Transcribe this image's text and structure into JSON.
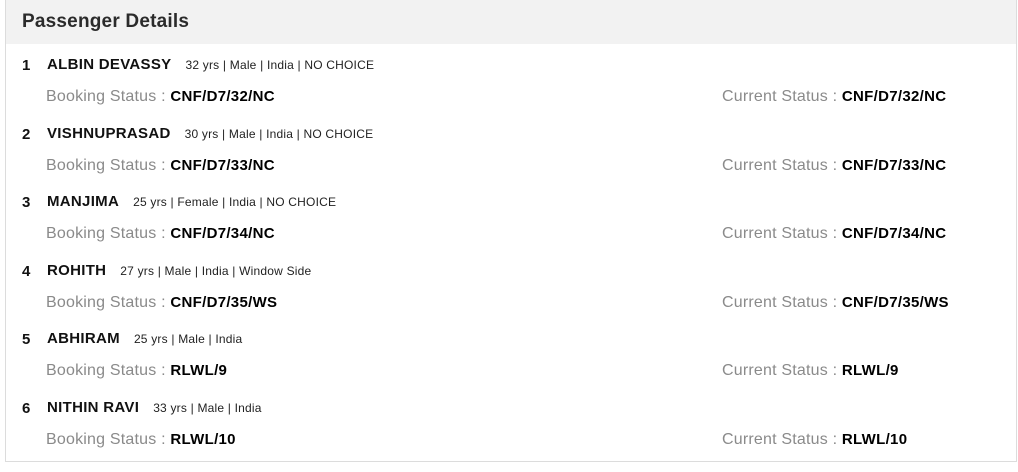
{
  "header": {
    "title": "Passenger Details"
  },
  "passengers": [
    {
      "number": "1",
      "name": "ALBIN DEVASSY",
      "info": "32 yrs | Male | India | NO CHOICE",
      "booking_label": "Booking Status : ",
      "booking_status": "CNF/D7/32/NC",
      "current_label": "Current Status : ",
      "current_status": "CNF/D7/32/NC"
    },
    {
      "number": "2",
      "name": "VISHNUPRASAD",
      "info": "30 yrs | Male | India | NO CHOICE",
      "booking_label": "Booking Status : ",
      "booking_status": "CNF/D7/33/NC",
      "current_label": "Current Status : ",
      "current_status": "CNF/D7/33/NC"
    },
    {
      "number": "3",
      "name": "MANJIMA",
      "info": "25 yrs | Female | India | NO CHOICE",
      "booking_label": "Booking Status : ",
      "booking_status": "CNF/D7/34/NC",
      "current_label": "Current Status : ",
      "current_status": "CNF/D7/34/NC"
    },
    {
      "number": "4",
      "name": "ROHITH",
      "info": "27 yrs | Male | India | Window Side",
      "booking_label": "Booking Status : ",
      "booking_status": "CNF/D7/35/WS",
      "current_label": "Current Status : ",
      "current_status": "CNF/D7/35/WS"
    },
    {
      "number": "5",
      "name": "ABHIRAM",
      "info": "25 yrs | Male | India",
      "booking_label": "Booking Status : ",
      "booking_status": "RLWL/9",
      "current_label": "Current Status : ",
      "current_status": "RLWL/9"
    },
    {
      "number": "6",
      "name": "NITHIN RAVI",
      "info": "33 yrs | Male | India",
      "booking_label": "Booking Status : ",
      "booking_status": "RLWL/10",
      "current_label": "Current Status : ",
      "current_status": "RLWL/10"
    }
  ]
}
